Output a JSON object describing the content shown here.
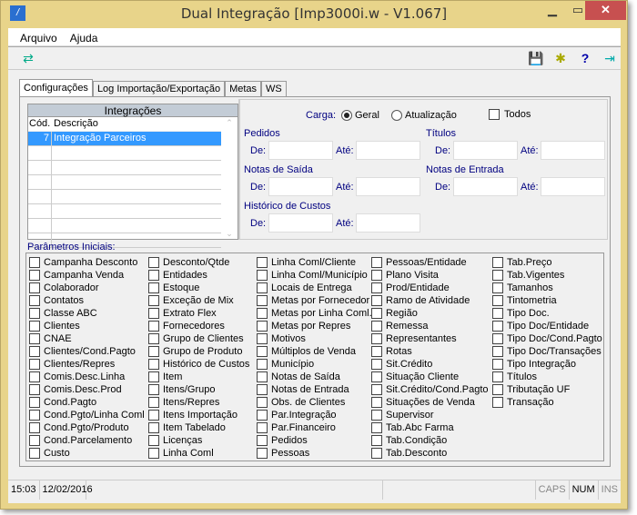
{
  "window": {
    "title": "Dual Integração [Imp3000i.w - V1.067]",
    "minimize": "▁",
    "maximize": "▭",
    "close": "✕"
  },
  "menu": [
    "Arquivo",
    "Ajuda"
  ],
  "toolbar": {
    "left": [
      "refresh-transfer-icon"
    ],
    "right": [
      "save-icon",
      "settings-icon",
      "help-icon",
      "exit-icon"
    ]
  },
  "tabs": [
    "Configurações",
    "Log Importação/Exportação",
    "Metas",
    "WS"
  ],
  "integracoes": {
    "title": "Integrações",
    "col_cod": "Cód.",
    "col_desc": "Descrição",
    "rows": [
      {
        "cod": "7",
        "desc": "Integração Parceiros"
      }
    ]
  },
  "filters": {
    "carga_label": "Carga:",
    "geral": "Geral",
    "atualizacao": "Atualização",
    "selected": "Geral",
    "todos": "Todos",
    "todos_checked": false,
    "de": "De:",
    "ate": "Até:",
    "pedidos": "Pedidos",
    "titulos": "Títulos",
    "notas_saida": "Notas de Saída",
    "notas_entrada": "Notas de Entrada",
    "historico_custos": "Histórico de Custos"
  },
  "params": {
    "label": "Parâmetros Iniciais:",
    "columns": [
      [
        "Campanha Desconto",
        "Campanha Venda",
        "Colaborador",
        "Contatos",
        "Classe ABC",
        "Clientes",
        "CNAE",
        "Clientes/Cond.Pagto",
        "Clientes/Repres",
        "Comis.Desc.Linha",
        "Comis.Desc.Prod",
        "Cond.Pagto",
        "Cond.Pgto/Linha Coml",
        "Cond.Pgto/Produto",
        "Cond.Parcelamento",
        "Custo"
      ],
      [
        "Desconto/Qtde",
        "Entidades",
        "Estoque",
        "Exceção de Mix",
        "Extrato Flex",
        "Fornecedores",
        "Grupo de Clientes",
        "Grupo de Produto",
        "Histórico de Custos",
        "Item",
        "Itens/Grupo",
        "Itens/Repres",
        "Itens Importação",
        "Item Tabelado",
        "Licenças",
        "Linha Coml"
      ],
      [
        "Linha Coml/Cliente",
        "Linha Coml/Município",
        "Locais de Entrega",
        "Metas por Fornecedor",
        "Metas por Linha Coml.",
        "Metas por Repres",
        "Motivos",
        "Múltiplos de Venda",
        "Município",
        "Notas de Saída",
        "Notas de Entrada",
        "Obs. de Clientes",
        "Par.Integração",
        "Par.Financeiro",
        "Pedidos",
        "Pessoas"
      ],
      [
        "Pessoas/Entidade",
        "Plano Visita",
        "Prod/Entidade",
        "Ramo de Atividade",
        "Região",
        "Remessa",
        "Representantes",
        "Rotas",
        "Sit.Crédito",
        "Situação Cliente",
        "Sit.Crédito/Cond.Pagto",
        "Situações de Venda",
        "Supervisor",
        "Tab.Abc Farma",
        "Tab.Condição",
        "Tab.Desconto"
      ],
      [
        "Tab.Preço",
        "Tab.Vigentes",
        "Tamanhos",
        "Tintometria",
        "Tipo Doc.",
        "Tipo Doc/Entidade",
        "Tipo Doc/Cond.Pagto",
        "Tipo Doc/Transações",
        "Tipo Integração",
        "Títulos",
        "Tributação UF",
        "Transação"
      ]
    ]
  },
  "status": {
    "time": "15:03",
    "date": "12/02/2016",
    "caps": "CAPS",
    "num": "NUM",
    "ins": "INS"
  }
}
